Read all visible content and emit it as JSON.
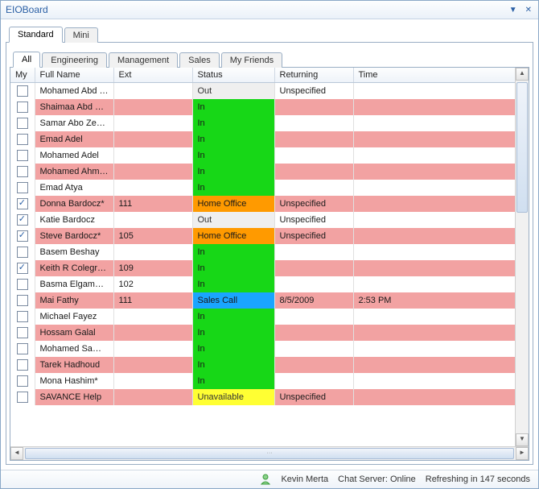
{
  "app": {
    "title": "EIOBoard"
  },
  "topTabs": [
    {
      "label": "Standard",
      "active": true
    },
    {
      "label": "Mini",
      "active": false
    }
  ],
  "filterTabs": [
    {
      "label": "All",
      "active": true
    },
    {
      "label": "Engineering",
      "active": false
    },
    {
      "label": "Management",
      "active": false
    },
    {
      "label": "Sales",
      "active": false
    },
    {
      "label": "My Friends",
      "active": false
    }
  ],
  "columns": {
    "my": "My",
    "fullName": "Full Name",
    "ext": "Ext",
    "status": "Status",
    "returning": "Returning",
    "time": "Time"
  },
  "statusColors": {
    "In": "green",
    "Out": "gray",
    "Home Office": "orange",
    "Sales Call": "blue",
    "Unavailable": "yellow"
  },
  "rows": [
    {
      "my": false,
      "name": "Mohamed Abd El...",
      "ext": "",
      "status": "Out",
      "returning": "Unspecified",
      "time": "",
      "tint": "white"
    },
    {
      "my": false,
      "name": "Shaimaa Abd El ...",
      "ext": "",
      "status": "In",
      "returning": "",
      "time": "",
      "tint": "pink"
    },
    {
      "my": false,
      "name": "Samar Abo Zeed*",
      "ext": "",
      "status": "In",
      "returning": "",
      "time": "",
      "tint": "white"
    },
    {
      "my": false,
      "name": "Emad Adel",
      "ext": "",
      "status": "In",
      "returning": "",
      "time": "",
      "tint": "pink"
    },
    {
      "my": false,
      "name": "Mohamed Adel",
      "ext": "",
      "status": "In",
      "returning": "",
      "time": "",
      "tint": "white"
    },
    {
      "my": false,
      "name": "Mohamed Ahmed",
      "ext": "",
      "status": "In",
      "returning": "",
      "time": "",
      "tint": "pink"
    },
    {
      "my": false,
      "name": "Emad Atya",
      "ext": "",
      "status": "In",
      "returning": "",
      "time": "",
      "tint": "white"
    },
    {
      "my": true,
      "name": "Donna Bardocz*",
      "ext": "111",
      "status": "Home Office",
      "returning": "Unspecified",
      "time": "",
      "tint": "pink"
    },
    {
      "my": true,
      "name": "Katie Bardocz",
      "ext": "",
      "status": "Out",
      "returning": "Unspecified",
      "time": "",
      "tint": "white"
    },
    {
      "my": true,
      "name": "Steve Bardocz*",
      "ext": "105",
      "status": "Home Office",
      "returning": "Unspecified",
      "time": "",
      "tint": "pink"
    },
    {
      "my": false,
      "name": "Basem Beshay",
      "ext": "",
      "status": "In",
      "returning": "",
      "time": "",
      "tint": "white"
    },
    {
      "my": true,
      "name": "Keith R Colegrove*",
      "ext": "109",
      "status": "In",
      "returning": "",
      "time": "",
      "tint": "pink"
    },
    {
      "my": false,
      "name": "Basma Elgammal*",
      "ext": "102",
      "status": "In",
      "returning": "",
      "time": "",
      "tint": "white"
    },
    {
      "my": false,
      "name": "Mai Fathy",
      "ext": "111",
      "status": "Sales Call",
      "returning": "8/5/2009",
      "time": "2:53 PM",
      "tint": "pink"
    },
    {
      "my": false,
      "name": "Michael Fayez",
      "ext": "",
      "status": "In",
      "returning": "",
      "time": "",
      "tint": "white"
    },
    {
      "my": false,
      "name": "Hossam Galal",
      "ext": "",
      "status": "In",
      "returning": "",
      "time": "",
      "tint": "pink"
    },
    {
      "my": false,
      "name": "Mohamed Same...",
      "ext": "",
      "status": "In",
      "returning": "",
      "time": "",
      "tint": "white"
    },
    {
      "my": false,
      "name": "Tarek Hadhoud",
      "ext": "",
      "status": "In",
      "returning": "",
      "time": "",
      "tint": "pink"
    },
    {
      "my": false,
      "name": "Mona Hashim*",
      "ext": "",
      "status": "In",
      "returning": "",
      "time": "",
      "tint": "white"
    },
    {
      "my": false,
      "name": "SAVANCE Help",
      "ext": "",
      "status": "Unavailable",
      "returning": "Unspecified",
      "time": "",
      "tint": "pink"
    }
  ],
  "statusbar": {
    "user": "Kevin Merta",
    "chatLabel": "Chat Server:",
    "chatStatus": "Online",
    "refreshing": "Refreshing in 147 seconds"
  }
}
